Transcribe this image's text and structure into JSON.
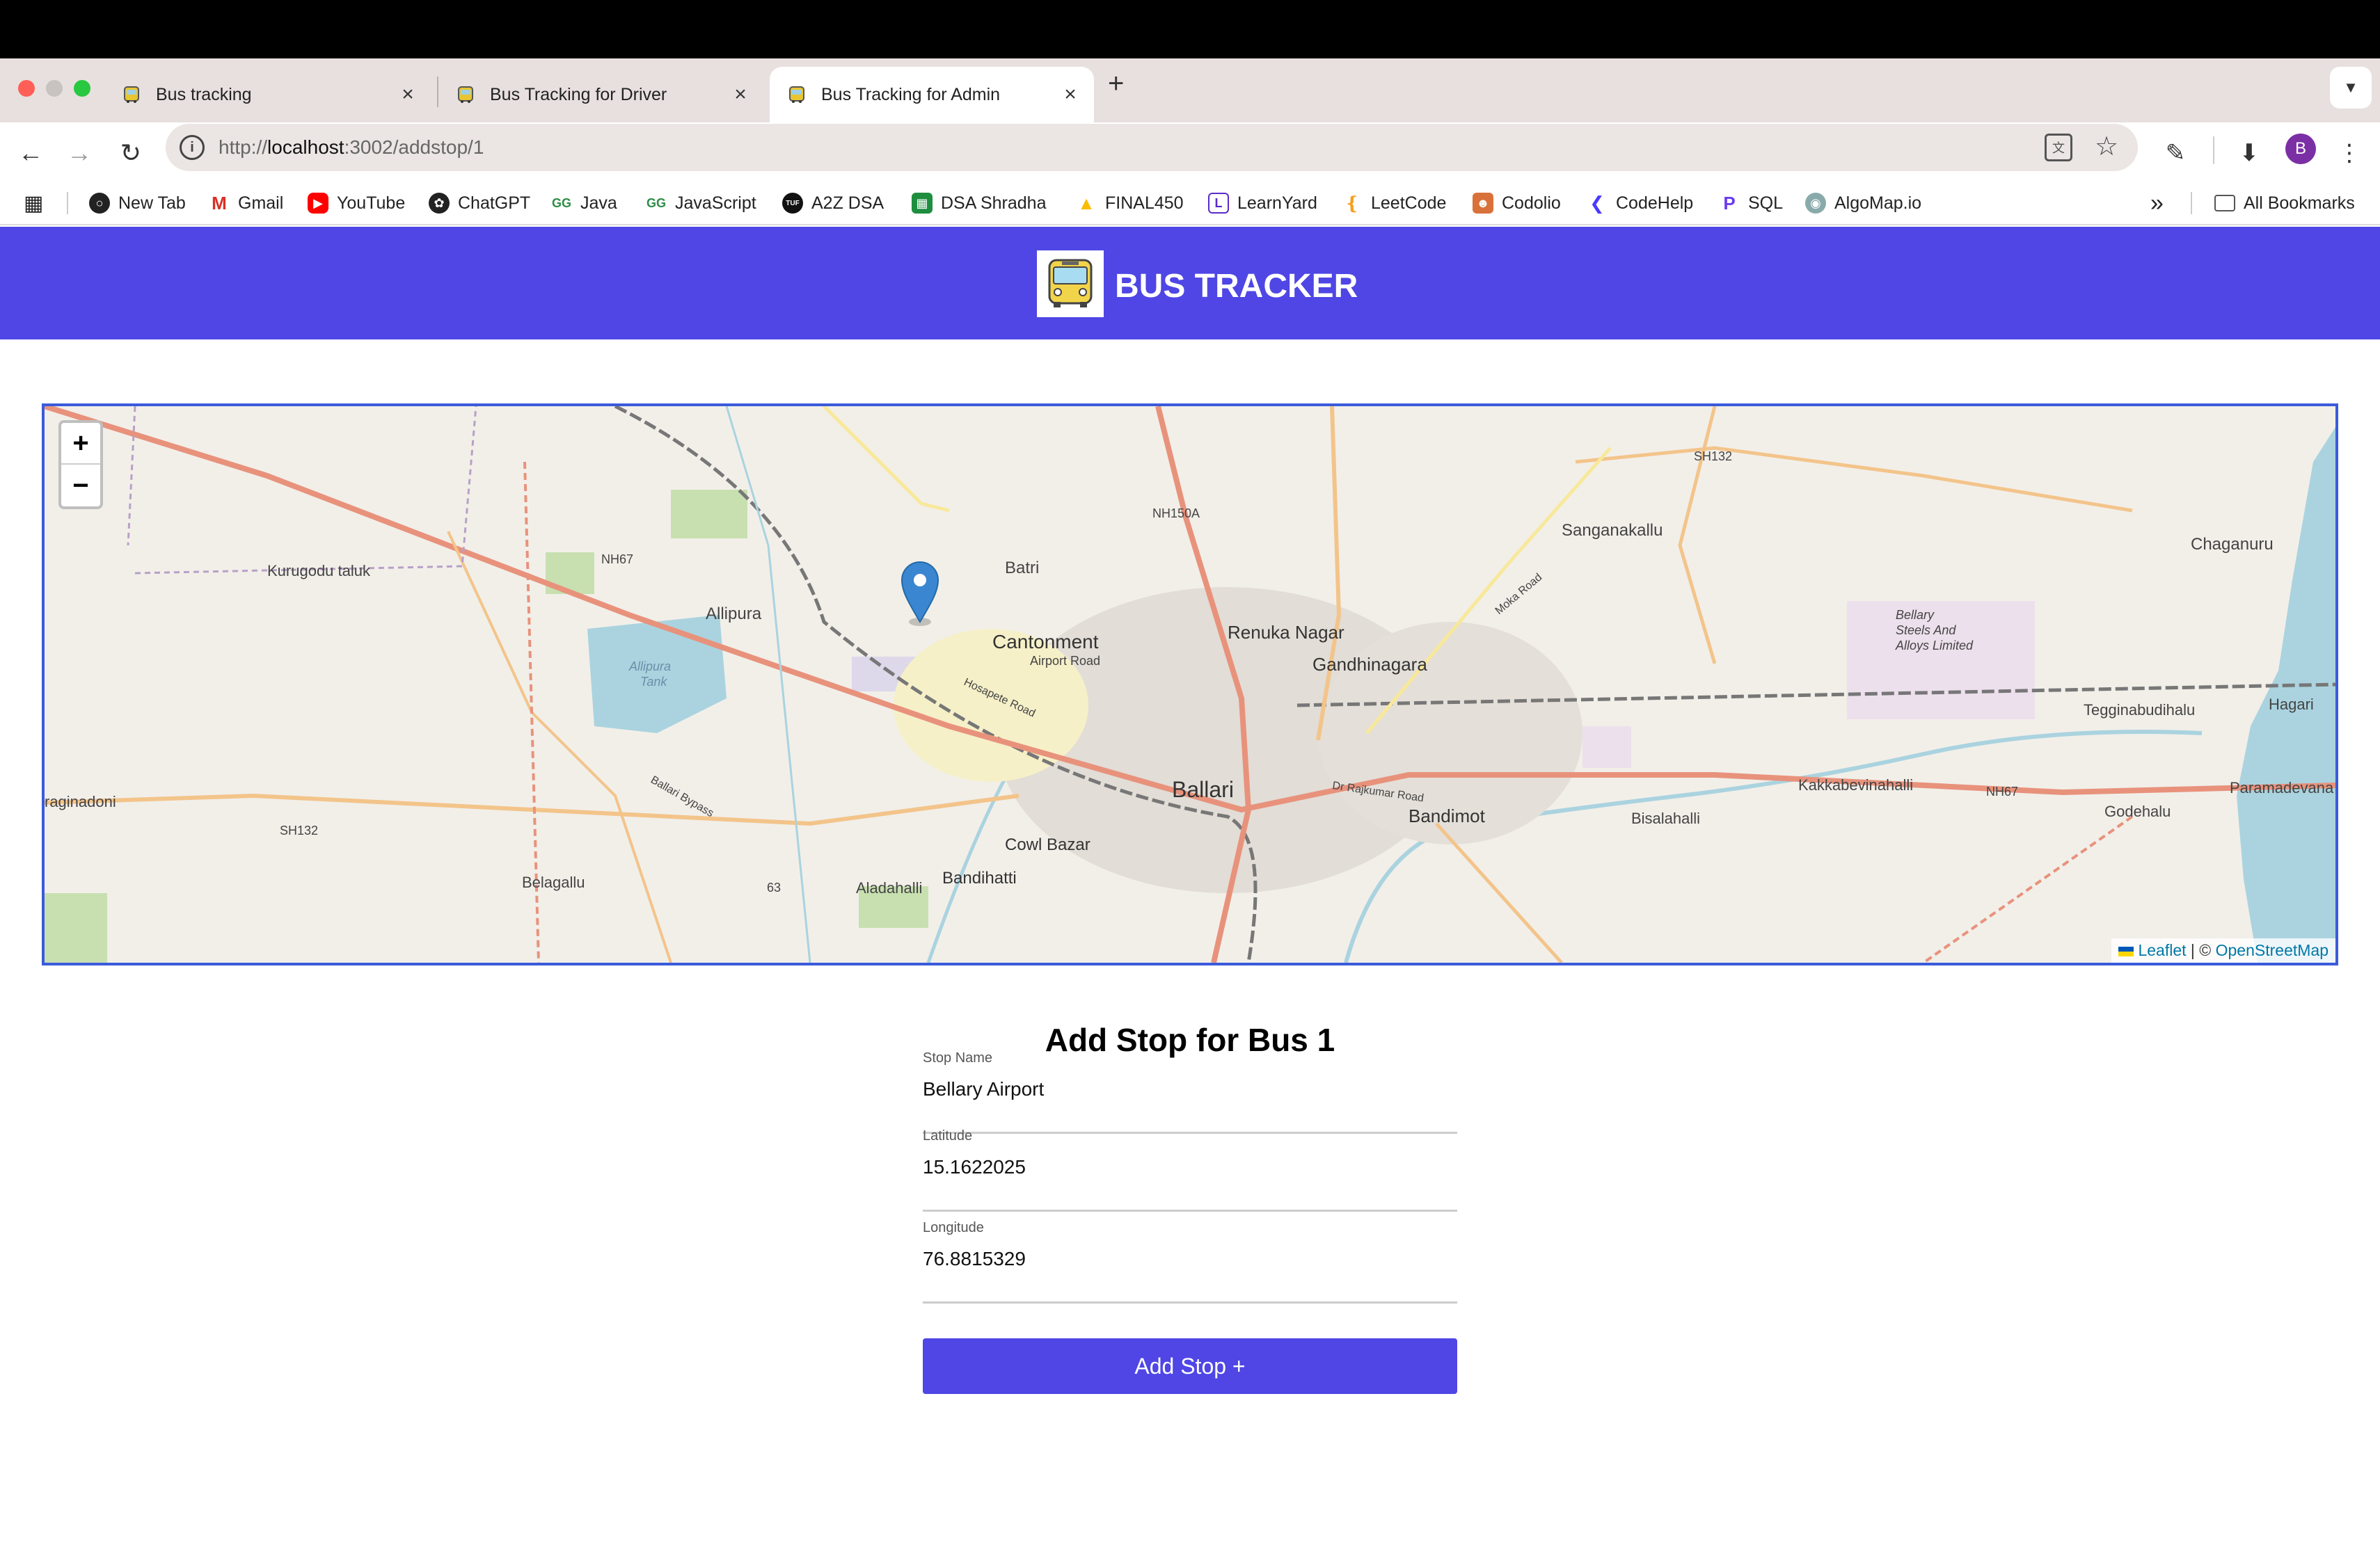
{
  "browser": {
    "tabs": [
      {
        "title": "Bus tracking",
        "close": "×"
      },
      {
        "title": "Bus Tracking for Driver",
        "close": "×"
      },
      {
        "title": "Bus Tracking for Admin",
        "close": "×"
      }
    ],
    "new_tab": "+",
    "url_prefix": "http://",
    "url_host": "localhost",
    "url_path": ":3002/addstop/1",
    "avatar_letter": "B",
    "bookmarks": [
      "New Tab",
      "Gmail",
      "YouTube",
      "ChatGPT",
      "Java",
      "JavaScript",
      "A2Z DSA",
      "DSA Shradha",
      "FINAL450",
      "LearnYard",
      "LeetCode",
      "Codolio",
      "CodeHelp",
      "SQL",
      "AlgoMap.io"
    ],
    "overflow": "»",
    "all_bookmarks": "All Bookmarks"
  },
  "app": {
    "brand": "BUS TRACKER",
    "accent": "#4f46e5"
  },
  "map": {
    "zoom_in": "+",
    "zoom_out": "−",
    "attribution_leaflet": "Leaflet",
    "attribution_sep": " | © ",
    "attribution_osm": "OpenStreetMap",
    "labels": {
      "kurugodu": "Kurugodu taluk",
      "nh67a": "NH67",
      "allipura": "Allipura",
      "allipura_tank": "Allipura",
      "tank": "Tank",
      "batri": "Batri",
      "nh150a": "NH150A",
      "sh132a": "SH132",
      "sanganakallu": "Sanganakallu",
      "chaganuru": "Chaganuru",
      "cantonment": "Cantonment",
      "airport_road": "Airport Road",
      "renuka": "Renuka Nagar",
      "gandhinagara": "Gandhinagara",
      "bellary_steels1": "Bellary",
      "bellary_steels2": "Steels And",
      "bellary_steels3": "Alloys Limited",
      "tegginabudihalu": "Tegginabudihalu",
      "hagari": "Hagari",
      "raginadoni": "raginadoni",
      "sh132b": "SH132",
      "ballari": "Ballari",
      "bandimot": "Bandimot",
      "kakkabevinahalli": "Kakkabevinahalli",
      "nh67b": "NH67",
      "paramadevana": "Paramadevana",
      "bisalahalli": "Bisalahalli",
      "godehalu": "Godehalu",
      "cowl_bazar": "Cowl Bazar",
      "bandihatti": "Bandihatti",
      "belagallu": "Belagallu",
      "aladahalli": "Aladahalli",
      "r63": "63",
      "ballari_bypass": "Ballari Bypass",
      "moka_road": "Moka Road",
      "hosapete_road": "Hosapete Road",
      "dr_rajkumar": "Dr Rajkumar Road"
    }
  },
  "form": {
    "title": "Add Stop for Bus 1",
    "fields": [
      {
        "label": "Stop Name",
        "value": "Bellary Airport"
      },
      {
        "label": "Latitude",
        "value": "15.1622025"
      },
      {
        "label": "Longitude",
        "value": "76.8815329"
      }
    ],
    "submit": "Add Stop +"
  }
}
